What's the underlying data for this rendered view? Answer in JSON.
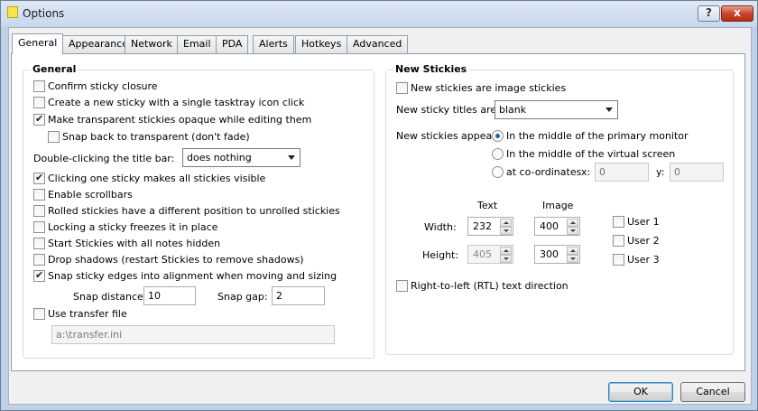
{
  "window": {
    "title": "Options",
    "help_glyph": "?",
    "close_glyph": "x"
  },
  "tabs": [
    "General",
    "Appearance",
    "Network",
    "Email",
    "PDA",
    "Alerts",
    "Hotkeys",
    "Advanced"
  ],
  "general": {
    "title": "General",
    "confirm_closure": {
      "label": "Confirm sticky closure",
      "checked": false
    },
    "single_click_create": {
      "label": "Create a new sticky with a single tasktray icon click",
      "checked": false
    },
    "transparent_opaque": {
      "label": "Make transparent stickies opaque while editing them",
      "checked": true
    },
    "snap_back": {
      "label": "Snap back to transparent (don't fade)",
      "checked": false
    },
    "double_click": {
      "label": "Double-clicking the title bar:",
      "value": "does nothing"
    },
    "one_sticky_visible": {
      "label": "Clicking one sticky makes all stickies visible",
      "checked": true
    },
    "scrollbars": {
      "label": "Enable scrollbars",
      "checked": false
    },
    "rolled_position": {
      "label": "Rolled stickies have a different position to unrolled stickies",
      "checked": false
    },
    "locking_freezes": {
      "label": "Locking a sticky freezes it in place",
      "checked": false
    },
    "start_hidden": {
      "label": "Start Stickies with all notes hidden",
      "checked": false
    },
    "drop_shadows": {
      "label": "Drop shadows (restart Stickies to remove shadows)",
      "checked": false
    },
    "snap_edges": {
      "label": "Snap sticky edges into alignment when moving and sizing",
      "checked": true
    },
    "snap_distance": {
      "label": "Snap distance:",
      "value": "10"
    },
    "snap_gap": {
      "label": "Snap gap:",
      "value": "2"
    },
    "transfer_file": {
      "label": "Use transfer file",
      "checked": false,
      "value": "a:\\transfer.ini"
    }
  },
  "new_stickies": {
    "title": "New Stickies",
    "image_stickies": {
      "label": "New stickies are image stickies",
      "checked": false
    },
    "titles": {
      "label": "New sticky titles are:",
      "value": "blank"
    },
    "appear": {
      "label": "New stickies appear:",
      "options": [
        "In the middle of the primary monitor",
        "In the middle of the virtual screen",
        "at co-ordinates"
      ],
      "selected": 0,
      "x_label": "x:",
      "x_value": "0",
      "y_label": "y:",
      "y_value": "0"
    },
    "size": {
      "text_header": "Text",
      "image_header": "Image",
      "width_label": "Width:",
      "height_label": "Height:",
      "text_width": "232",
      "image_width": "400",
      "text_height": "405",
      "image_height": "300"
    },
    "users": [
      "User 1",
      "User 2",
      "User 3"
    ],
    "rtl": {
      "label": "Right-to-left (RTL) text direction",
      "checked": false
    }
  },
  "buttons": {
    "ok": "OK",
    "cancel": "Cancel"
  }
}
